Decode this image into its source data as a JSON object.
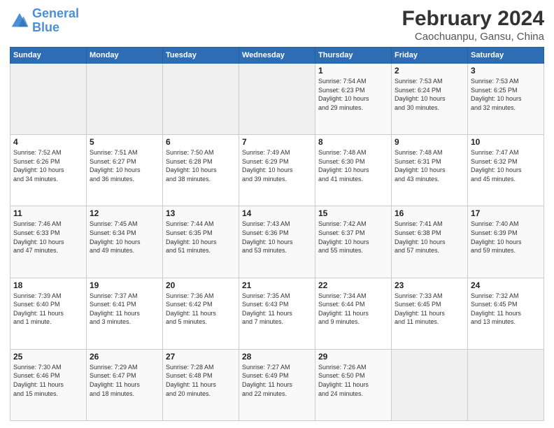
{
  "logo": {
    "line1": "General",
    "line2": "Blue"
  },
  "title": "February 2024",
  "subtitle": "Caochuanpu, Gansu, China",
  "header_days": [
    "Sunday",
    "Monday",
    "Tuesday",
    "Wednesday",
    "Thursday",
    "Friday",
    "Saturday"
  ],
  "weeks": [
    [
      {
        "day": "",
        "info": ""
      },
      {
        "day": "",
        "info": ""
      },
      {
        "day": "",
        "info": ""
      },
      {
        "day": "",
        "info": ""
      },
      {
        "day": "1",
        "info": "Sunrise: 7:54 AM\nSunset: 6:23 PM\nDaylight: 10 hours\nand 29 minutes."
      },
      {
        "day": "2",
        "info": "Sunrise: 7:53 AM\nSunset: 6:24 PM\nDaylight: 10 hours\nand 30 minutes."
      },
      {
        "day": "3",
        "info": "Sunrise: 7:53 AM\nSunset: 6:25 PM\nDaylight: 10 hours\nand 32 minutes."
      }
    ],
    [
      {
        "day": "4",
        "info": "Sunrise: 7:52 AM\nSunset: 6:26 PM\nDaylight: 10 hours\nand 34 minutes."
      },
      {
        "day": "5",
        "info": "Sunrise: 7:51 AM\nSunset: 6:27 PM\nDaylight: 10 hours\nand 36 minutes."
      },
      {
        "day": "6",
        "info": "Sunrise: 7:50 AM\nSunset: 6:28 PM\nDaylight: 10 hours\nand 38 minutes."
      },
      {
        "day": "7",
        "info": "Sunrise: 7:49 AM\nSunset: 6:29 PM\nDaylight: 10 hours\nand 39 minutes."
      },
      {
        "day": "8",
        "info": "Sunrise: 7:48 AM\nSunset: 6:30 PM\nDaylight: 10 hours\nand 41 minutes."
      },
      {
        "day": "9",
        "info": "Sunrise: 7:48 AM\nSunset: 6:31 PM\nDaylight: 10 hours\nand 43 minutes."
      },
      {
        "day": "10",
        "info": "Sunrise: 7:47 AM\nSunset: 6:32 PM\nDaylight: 10 hours\nand 45 minutes."
      }
    ],
    [
      {
        "day": "11",
        "info": "Sunrise: 7:46 AM\nSunset: 6:33 PM\nDaylight: 10 hours\nand 47 minutes."
      },
      {
        "day": "12",
        "info": "Sunrise: 7:45 AM\nSunset: 6:34 PM\nDaylight: 10 hours\nand 49 minutes."
      },
      {
        "day": "13",
        "info": "Sunrise: 7:44 AM\nSunset: 6:35 PM\nDaylight: 10 hours\nand 51 minutes."
      },
      {
        "day": "14",
        "info": "Sunrise: 7:43 AM\nSunset: 6:36 PM\nDaylight: 10 hours\nand 53 minutes."
      },
      {
        "day": "15",
        "info": "Sunrise: 7:42 AM\nSunset: 6:37 PM\nDaylight: 10 hours\nand 55 minutes."
      },
      {
        "day": "16",
        "info": "Sunrise: 7:41 AM\nSunset: 6:38 PM\nDaylight: 10 hours\nand 57 minutes."
      },
      {
        "day": "17",
        "info": "Sunrise: 7:40 AM\nSunset: 6:39 PM\nDaylight: 10 hours\nand 59 minutes."
      }
    ],
    [
      {
        "day": "18",
        "info": "Sunrise: 7:39 AM\nSunset: 6:40 PM\nDaylight: 11 hours\nand 1 minute."
      },
      {
        "day": "19",
        "info": "Sunrise: 7:37 AM\nSunset: 6:41 PM\nDaylight: 11 hours\nand 3 minutes."
      },
      {
        "day": "20",
        "info": "Sunrise: 7:36 AM\nSunset: 6:42 PM\nDaylight: 11 hours\nand 5 minutes."
      },
      {
        "day": "21",
        "info": "Sunrise: 7:35 AM\nSunset: 6:43 PM\nDaylight: 11 hours\nand 7 minutes."
      },
      {
        "day": "22",
        "info": "Sunrise: 7:34 AM\nSunset: 6:44 PM\nDaylight: 11 hours\nand 9 minutes."
      },
      {
        "day": "23",
        "info": "Sunrise: 7:33 AM\nSunset: 6:45 PM\nDaylight: 11 hours\nand 11 minutes."
      },
      {
        "day": "24",
        "info": "Sunrise: 7:32 AM\nSunset: 6:45 PM\nDaylight: 11 hours\nand 13 minutes."
      }
    ],
    [
      {
        "day": "25",
        "info": "Sunrise: 7:30 AM\nSunset: 6:46 PM\nDaylight: 11 hours\nand 15 minutes."
      },
      {
        "day": "26",
        "info": "Sunrise: 7:29 AM\nSunset: 6:47 PM\nDaylight: 11 hours\nand 18 minutes."
      },
      {
        "day": "27",
        "info": "Sunrise: 7:28 AM\nSunset: 6:48 PM\nDaylight: 11 hours\nand 20 minutes."
      },
      {
        "day": "28",
        "info": "Sunrise: 7:27 AM\nSunset: 6:49 PM\nDaylight: 11 hours\nand 22 minutes."
      },
      {
        "day": "29",
        "info": "Sunrise: 7:26 AM\nSunset: 6:50 PM\nDaylight: 11 hours\nand 24 minutes."
      },
      {
        "day": "",
        "info": ""
      },
      {
        "day": "",
        "info": ""
      }
    ]
  ]
}
